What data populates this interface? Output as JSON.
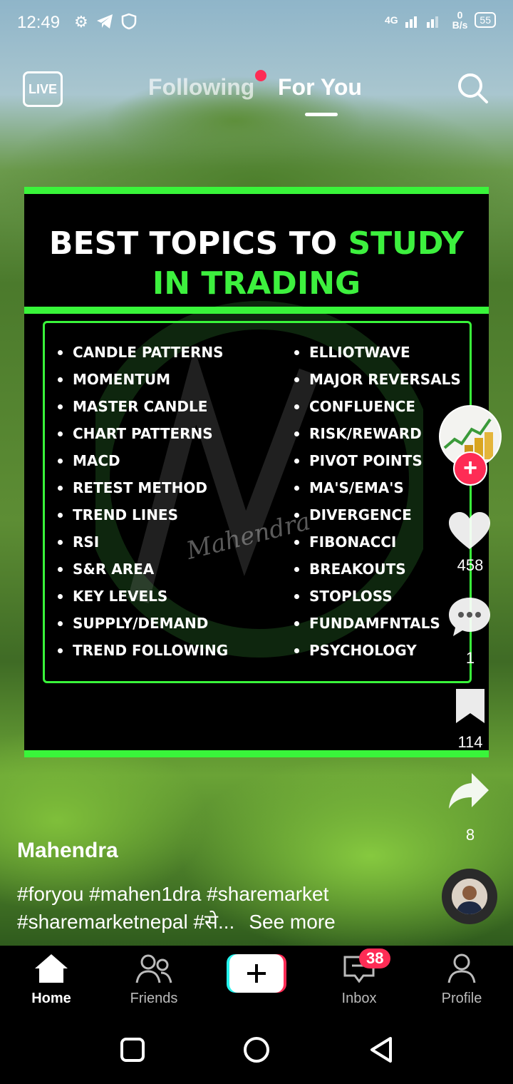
{
  "status_bar": {
    "time": "12:49",
    "network": "4G",
    "speed_value": "0",
    "speed_unit": "B/s",
    "battery": "55"
  },
  "top_nav": {
    "live_label": "LIVE",
    "tab_following": "Following",
    "tab_for_you": "For You"
  },
  "post": {
    "title_white": "BEST TOPICS TO ",
    "title_green_1": "STUDY",
    "title_green_2": "IN TRADING",
    "watermark": "Mahendra",
    "left_items": [
      "CANDLE PATTERNS",
      "MOMENTUM",
      "MASTER CANDLE",
      "CHART PATTERNS",
      "MACD",
      "RETEST METHOD",
      "TREND LINES",
      "RSI",
      "S&R AREA",
      "KEY LEVELS",
      "SUPPLY/DEMAND",
      "TREND FOLLOWING"
    ],
    "right_items": [
      "ELLIOTWAVE",
      "MAJOR REVERSALS",
      "CONFLUENCE",
      "RISK/REWARD",
      "PIVOT POINTS",
      "MA'S/EMA'S",
      "DIVERGENCE",
      "FIBONACCI",
      "BREAKOUTS",
      "STOPLOSS",
      "FUNDAMFNTALS",
      "PSYCHOLOGY"
    ]
  },
  "rail": {
    "likes": "458",
    "comments": "1",
    "saves": "114",
    "shares": "8"
  },
  "caption": {
    "author": "Mahendra",
    "line1": "#foryou #mahen1dra #sharemarket",
    "line2": "#sharemarketnepal #से...",
    "see_more": "See more"
  },
  "bottom_nav": {
    "home": "Home",
    "friends": "Friends",
    "inbox": "Inbox",
    "inbox_badge": "38",
    "profile": "Profile"
  },
  "colors": {
    "accent_green": "#3df03e",
    "brand_red": "#fe2c55"
  }
}
